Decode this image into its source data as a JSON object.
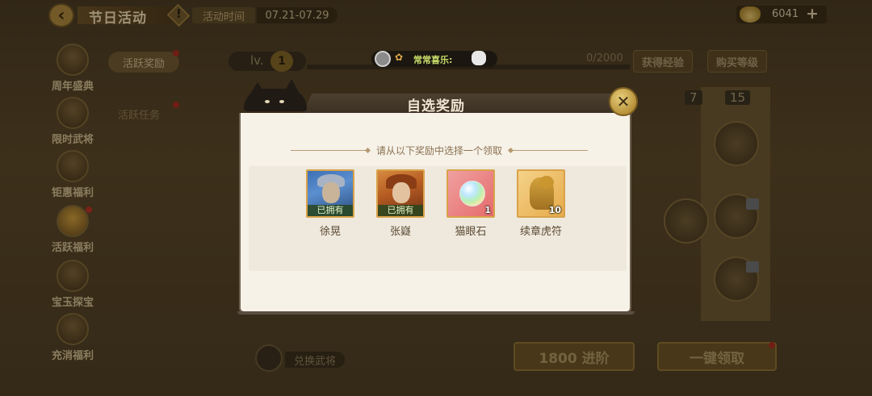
{
  "header": {
    "title": "节日活动",
    "time_label": "活动时间",
    "time_range": "07.21-07.29",
    "currency_value": "6041"
  },
  "sidebar": {
    "items": [
      {
        "label": "周年盛典",
        "dot": false
      },
      {
        "label": "限时武将",
        "dot": false
      },
      {
        "label": "钜惠福利",
        "dot": false
      },
      {
        "label": "活跃福利",
        "dot": true
      },
      {
        "label": "宝玉探宝",
        "dot": false
      },
      {
        "label": "充消福利",
        "dot": false
      }
    ]
  },
  "sub_tabs": [
    "活跃奖励",
    "活跃任务"
  ],
  "level": {
    "prefix": "lv.",
    "value": "1",
    "progress_text": "0/2000",
    "gain_exp_label": "获得经验",
    "buy_level_label": "购买等级"
  },
  "toast": {
    "text": "常常喜乐:"
  },
  "tier_badges": [
    "7",
    "15"
  ],
  "bottom": {
    "exchange_label": "兑换武将",
    "advance_label": "1800 进阶",
    "claim_all_label": "一键领取"
  },
  "modal": {
    "title": "自选奖励",
    "instruction": "请从以下奖励中选择一个领取",
    "rewards": [
      {
        "name": "徐晃",
        "tag": "已拥有",
        "qty": ""
      },
      {
        "name": "张嶷",
        "tag": "已拥有",
        "qty": ""
      },
      {
        "name": "猫眼石",
        "tag": "",
        "qty": "1"
      },
      {
        "name": "续章虎符",
        "tag": "",
        "qty": "10"
      }
    ]
  },
  "colors": {
    "accent_gold": "#d9a24a",
    "owned_tag_bg": "#284620",
    "modal_bg": "#f7f2e8"
  }
}
